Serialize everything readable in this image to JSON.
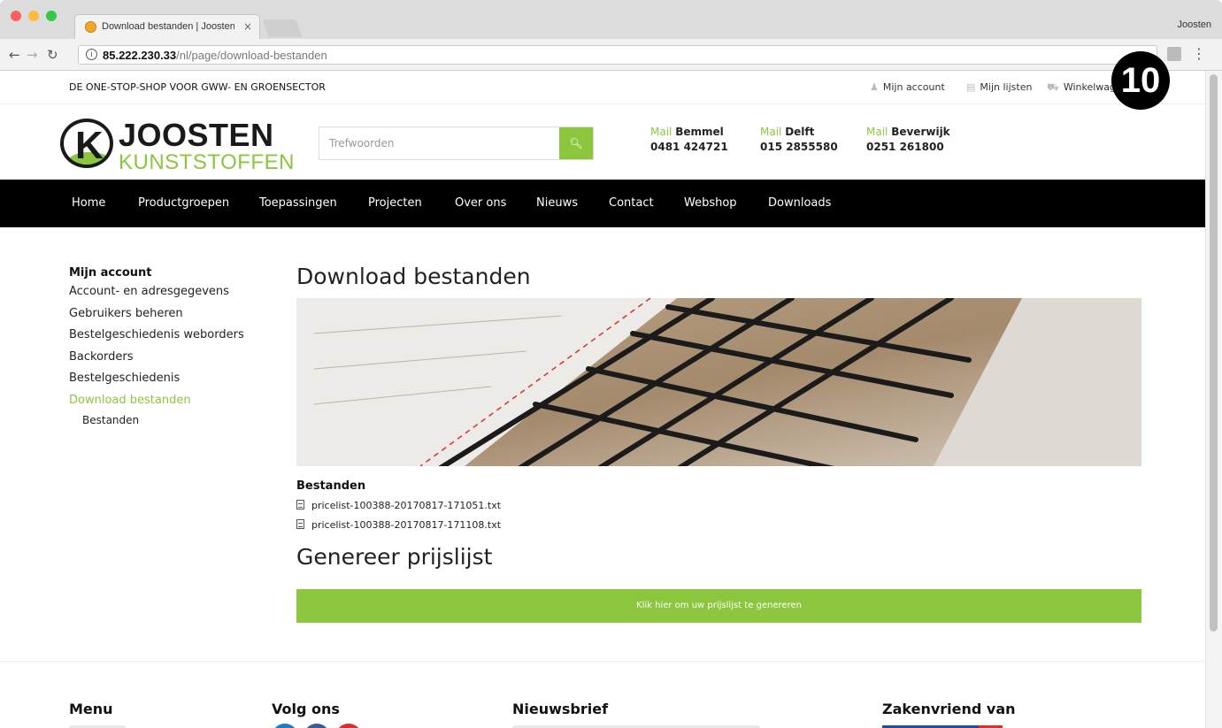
{
  "browser": {
    "tab_title": "Download bestanden | Joosten",
    "tab_close": "×",
    "profile": "Joosten",
    "url_host": "85.222.230.33",
    "url_path": "/nl/page/download-bestanden",
    "step_badge": "10"
  },
  "topbar": {
    "tagline": "DE ONE-STOP-SHOP VOOR GWW- EN GROENSECTOR",
    "account": "Mijn account",
    "lists": "Mijn lijsten",
    "cart": "Winkelwagen"
  },
  "logo": {
    "name": "JOOSTEN",
    "sub": "KUNSTSTOFFEN"
  },
  "search": {
    "placeholder": "Trefwoorden"
  },
  "contacts": [
    {
      "mail": "Mail",
      "city": "Bemmel",
      "phone": "0481 424721"
    },
    {
      "mail": "Mail",
      "city": "Delft",
      "phone": "015 2855580"
    },
    {
      "mail": "Mail",
      "city": "Beverwijk",
      "phone": "0251 261800"
    }
  ],
  "nav": [
    "Home",
    "Productgroepen",
    "Toepassingen",
    "Projecten",
    "Over ons",
    "Nieuws",
    "Contact",
    "Webshop",
    "Downloads"
  ],
  "sidebar": {
    "title": "Mijn account",
    "items": [
      "Account- en adresgegevens",
      "Gebruikers beheren",
      "Bestelgeschiedenis weborders",
      "Backorders",
      "Bestelgeschiedenis",
      "Download bestanden"
    ],
    "sub": "Bestanden"
  },
  "content": {
    "title": "Download bestanden",
    "files_heading": "Bestanden",
    "files": [
      "pricelist-100388-20170817-171051.txt",
      "pricelist-100388-20170817-171108.txt"
    ],
    "gen_title": "Genereer prijslijst",
    "gen_button": "Klik hier om uw prijslijst te genereren"
  },
  "footer": {
    "menu": "Menu",
    "follow": "Volg ons",
    "newsletter": "Nieuwsbrief",
    "partner": "Zakenvriend van"
  },
  "colors": {
    "accent": "#8cc63f",
    "nav_bg": "#000000"
  }
}
